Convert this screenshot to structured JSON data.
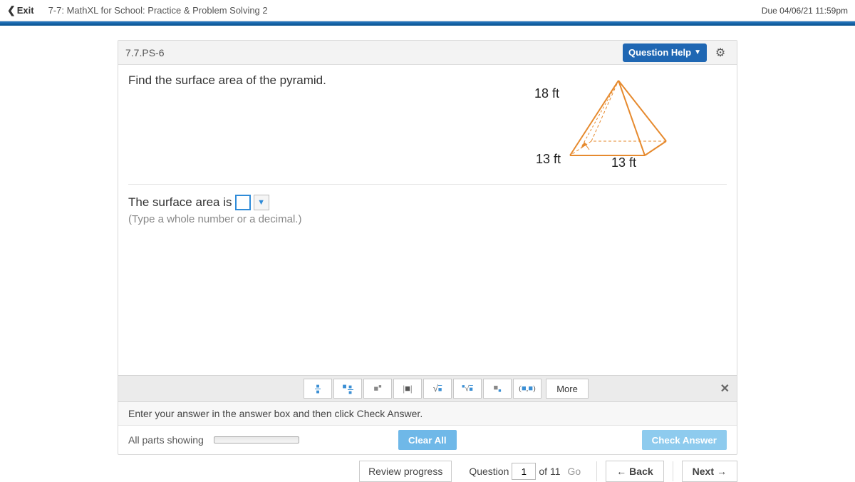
{
  "header": {
    "exit": "Exit",
    "title": "7-7: MathXL for School: Practice & Problem Solving 2",
    "due": "Due 04/06/21 11:59pm"
  },
  "panel": {
    "qid": "7.7.PS-6",
    "help": "Question Help",
    "problem_text": "Find the surface area of the pyramid.",
    "figure": {
      "slant": "18 ft",
      "base1": "13 ft",
      "base2": "13 ft"
    },
    "answer_prefix": "The surface area is",
    "hint": "(Type a whole number or a decimal.)",
    "palette": {
      "more": "More",
      "tools": {
        "fraction": "fraction",
        "mixed": "mixed-number",
        "exponent": "exponent",
        "abs": "|□|",
        "sqrt": "√",
        "nroot": "ⁿ√",
        "sub": "subscript",
        "pair": "(□,□)"
      }
    },
    "instruction": "Enter your answer in the answer box and then click Check Answer.",
    "parts_label": "All parts showing",
    "clear": "Clear All",
    "check": "Check Answer"
  },
  "nav": {
    "review": "Review progress",
    "question_label": "Question",
    "current": "1",
    "of_label": "of 11",
    "go": "Go",
    "back": "Back",
    "next": "Next"
  }
}
